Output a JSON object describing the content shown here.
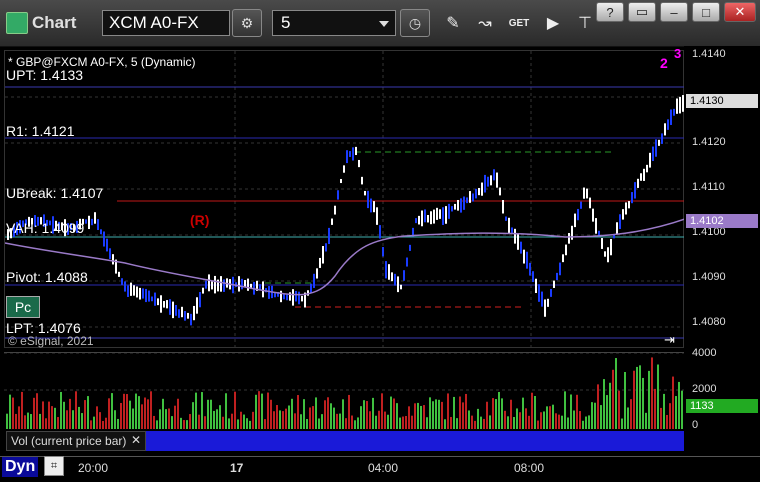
{
  "app": {
    "title": "Chart"
  },
  "toolbar": {
    "symbol": "XCM A0-FX",
    "interval": "5",
    "get_label": "GET",
    "help_label": "?"
  },
  "chart": {
    "header": "* GBP@FXCM A0-FX, 5 (Dynamic)",
    "levels": {
      "upt": "UPT: 1.4133",
      "r1": "R1: 1.4121",
      "ubreak": "UBreak: 1.4107",
      "vah": "VAH: 1.4099",
      "pivot": "Pivot: 1.4088",
      "lpt": "LPT: 1.4076"
    },
    "r_marker": "(R)",
    "pc_label": "Pc",
    "watermark": "© eSignal, 2021",
    "count_labels": [
      "2",
      "3"
    ],
    "y_ticks": [
      "1.4140",
      "1.4130",
      "1.4120",
      "1.4110",
      "1.4100",
      "1.4090",
      "1.4080"
    ],
    "price_tags": {
      "last": "1.4130",
      "vwap": "1.4102"
    },
    "colors": {
      "up_bar": "#ffffff",
      "down_bar": "#1a3cff",
      "vwap": "#9a7ac8",
      "r1": "#2a2ab0",
      "ubreak": "#c01818",
      "vah": "#40b0b0",
      "magenta": "#ff00ff",
      "green_count": "#00c000"
    }
  },
  "volume": {
    "label": "Vol (current price bar)",
    "y_ticks": [
      "4000",
      "2000",
      "0"
    ],
    "current": "1133"
  },
  "xaxis": {
    "ticks": [
      "20:00",
      "17",
      "04:00",
      "08:00"
    ],
    "dyn_label": "Dyn"
  }
}
